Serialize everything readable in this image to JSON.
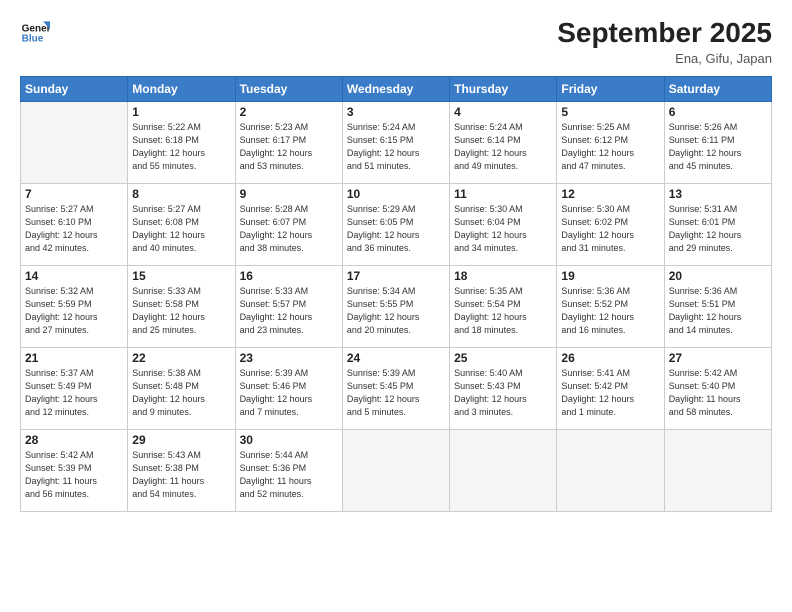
{
  "logo": {
    "line1": "General",
    "line2": "Blue"
  },
  "title": "September 2025",
  "location": "Ena, Gifu, Japan",
  "days_header": [
    "Sunday",
    "Monday",
    "Tuesday",
    "Wednesday",
    "Thursday",
    "Friday",
    "Saturday"
  ],
  "weeks": [
    [
      {
        "day": "",
        "info": ""
      },
      {
        "day": "1",
        "info": "Sunrise: 5:22 AM\nSunset: 6:18 PM\nDaylight: 12 hours\nand 55 minutes."
      },
      {
        "day": "2",
        "info": "Sunrise: 5:23 AM\nSunset: 6:17 PM\nDaylight: 12 hours\nand 53 minutes."
      },
      {
        "day": "3",
        "info": "Sunrise: 5:24 AM\nSunset: 6:15 PM\nDaylight: 12 hours\nand 51 minutes."
      },
      {
        "day": "4",
        "info": "Sunrise: 5:24 AM\nSunset: 6:14 PM\nDaylight: 12 hours\nand 49 minutes."
      },
      {
        "day": "5",
        "info": "Sunrise: 5:25 AM\nSunset: 6:12 PM\nDaylight: 12 hours\nand 47 minutes."
      },
      {
        "day": "6",
        "info": "Sunrise: 5:26 AM\nSunset: 6:11 PM\nDaylight: 12 hours\nand 45 minutes."
      }
    ],
    [
      {
        "day": "7",
        "info": "Sunrise: 5:27 AM\nSunset: 6:10 PM\nDaylight: 12 hours\nand 42 minutes."
      },
      {
        "day": "8",
        "info": "Sunrise: 5:27 AM\nSunset: 6:08 PM\nDaylight: 12 hours\nand 40 minutes."
      },
      {
        "day": "9",
        "info": "Sunrise: 5:28 AM\nSunset: 6:07 PM\nDaylight: 12 hours\nand 38 minutes."
      },
      {
        "day": "10",
        "info": "Sunrise: 5:29 AM\nSunset: 6:05 PM\nDaylight: 12 hours\nand 36 minutes."
      },
      {
        "day": "11",
        "info": "Sunrise: 5:30 AM\nSunset: 6:04 PM\nDaylight: 12 hours\nand 34 minutes."
      },
      {
        "day": "12",
        "info": "Sunrise: 5:30 AM\nSunset: 6:02 PM\nDaylight: 12 hours\nand 31 minutes."
      },
      {
        "day": "13",
        "info": "Sunrise: 5:31 AM\nSunset: 6:01 PM\nDaylight: 12 hours\nand 29 minutes."
      }
    ],
    [
      {
        "day": "14",
        "info": "Sunrise: 5:32 AM\nSunset: 5:59 PM\nDaylight: 12 hours\nand 27 minutes."
      },
      {
        "day": "15",
        "info": "Sunrise: 5:33 AM\nSunset: 5:58 PM\nDaylight: 12 hours\nand 25 minutes."
      },
      {
        "day": "16",
        "info": "Sunrise: 5:33 AM\nSunset: 5:57 PM\nDaylight: 12 hours\nand 23 minutes."
      },
      {
        "day": "17",
        "info": "Sunrise: 5:34 AM\nSunset: 5:55 PM\nDaylight: 12 hours\nand 20 minutes."
      },
      {
        "day": "18",
        "info": "Sunrise: 5:35 AM\nSunset: 5:54 PM\nDaylight: 12 hours\nand 18 minutes."
      },
      {
        "day": "19",
        "info": "Sunrise: 5:36 AM\nSunset: 5:52 PM\nDaylight: 12 hours\nand 16 minutes."
      },
      {
        "day": "20",
        "info": "Sunrise: 5:36 AM\nSunset: 5:51 PM\nDaylight: 12 hours\nand 14 minutes."
      }
    ],
    [
      {
        "day": "21",
        "info": "Sunrise: 5:37 AM\nSunset: 5:49 PM\nDaylight: 12 hours\nand 12 minutes."
      },
      {
        "day": "22",
        "info": "Sunrise: 5:38 AM\nSunset: 5:48 PM\nDaylight: 12 hours\nand 9 minutes."
      },
      {
        "day": "23",
        "info": "Sunrise: 5:39 AM\nSunset: 5:46 PM\nDaylight: 12 hours\nand 7 minutes."
      },
      {
        "day": "24",
        "info": "Sunrise: 5:39 AM\nSunset: 5:45 PM\nDaylight: 12 hours\nand 5 minutes."
      },
      {
        "day": "25",
        "info": "Sunrise: 5:40 AM\nSunset: 5:43 PM\nDaylight: 12 hours\nand 3 minutes."
      },
      {
        "day": "26",
        "info": "Sunrise: 5:41 AM\nSunset: 5:42 PM\nDaylight: 12 hours\nand 1 minute."
      },
      {
        "day": "27",
        "info": "Sunrise: 5:42 AM\nSunset: 5:40 PM\nDaylight: 11 hours\nand 58 minutes."
      }
    ],
    [
      {
        "day": "28",
        "info": "Sunrise: 5:42 AM\nSunset: 5:39 PM\nDaylight: 11 hours\nand 56 minutes."
      },
      {
        "day": "29",
        "info": "Sunrise: 5:43 AM\nSunset: 5:38 PM\nDaylight: 11 hours\nand 54 minutes."
      },
      {
        "day": "30",
        "info": "Sunrise: 5:44 AM\nSunset: 5:36 PM\nDaylight: 11 hours\nand 52 minutes."
      },
      {
        "day": "",
        "info": ""
      },
      {
        "day": "",
        "info": ""
      },
      {
        "day": "",
        "info": ""
      },
      {
        "day": "",
        "info": ""
      }
    ]
  ]
}
